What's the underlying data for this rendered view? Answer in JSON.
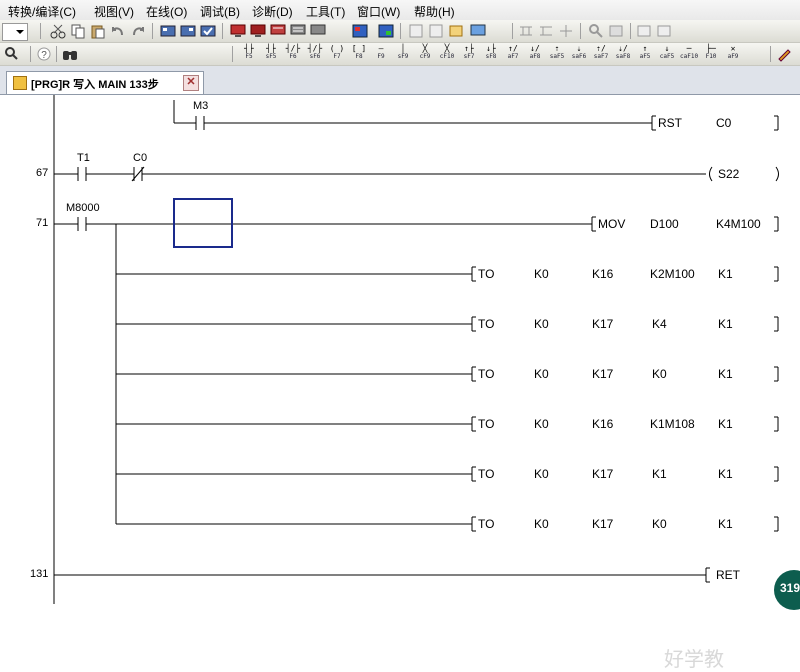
{
  "menu": [
    "转换/编译(C)",
    "视图(V)",
    "在线(O)",
    "调试(B)",
    "诊断(D)",
    "工具(T)",
    "窗口(W)",
    "帮助(H)"
  ],
  "toolbar2_keys": [
    {
      "sym": "┤├",
      "lab": "F5"
    },
    {
      "sym": "┤├",
      "lab": "sF5"
    },
    {
      "sym": "┤/├",
      "lab": "F6"
    },
    {
      "sym": "┤/├",
      "lab": "sF6"
    },
    {
      "sym": "( )",
      "lab": "F7"
    },
    {
      "sym": "[ ]",
      "lab": "F8"
    },
    {
      "sym": "—",
      "lab": "F9"
    },
    {
      "sym": "│",
      "lab": "sF9"
    },
    {
      "sym": "╳",
      "lab": "cF9"
    },
    {
      "sym": "╳",
      "lab": "cF10"
    },
    {
      "sym": "↑├",
      "lab": "sF7"
    },
    {
      "sym": "↓├",
      "lab": "sF8"
    },
    {
      "sym": "↑/",
      "lab": "aF7"
    },
    {
      "sym": "↓/",
      "lab": "aF8"
    },
    {
      "sym": "⇡",
      "lab": "saF5"
    },
    {
      "sym": "⇣",
      "lab": "saF6"
    },
    {
      "sym": "⇡/",
      "lab": "saF7"
    },
    {
      "sym": "⇣/",
      "lab": "saF8"
    },
    {
      "sym": "↑",
      "lab": "aF5"
    },
    {
      "sym": "↓",
      "lab": "caF5"
    },
    {
      "sym": "─",
      "lab": "caF10"
    },
    {
      "sym": "├─",
      "lab": "F10"
    },
    {
      "sym": "✕",
      "lab": "aF9"
    }
  ],
  "tab": {
    "label": "[PRG]R 写入 MAIN 133步",
    "close": "✕"
  },
  "steps": {
    "s67": "67",
    "s71": "71",
    "s131": "131"
  },
  "contacts": {
    "m3": "M3",
    "t1": "T1",
    "c0": "C0",
    "m8000": "M8000"
  },
  "instructions": {
    "rst": {
      "op": "RST",
      "arg": "C0"
    },
    "out": {
      "op": "S22"
    },
    "mov": {
      "op": "MOV",
      "a1": "D100",
      "a2": "K4M100"
    },
    "to": [
      {
        "op": "TO",
        "a1": "K0",
        "a2": "K16",
        "a3": "K2M100",
        "a4": "K1"
      },
      {
        "op": "TO",
        "a1": "K0",
        "a2": "K17",
        "a3": "K4",
        "a4": "K1"
      },
      {
        "op": "TO",
        "a1": "K0",
        "a2": "K17",
        "a3": "K0",
        "a4": "K1"
      },
      {
        "op": "TO",
        "a1": "K0",
        "a2": "K16",
        "a3": "K1M108",
        "a4": "K1"
      },
      {
        "op": "TO",
        "a1": "K0",
        "a2": "K17",
        "a3": "K1",
        "a4": "K1"
      },
      {
        "op": "TO",
        "a1": "K0",
        "a2": "K17",
        "a3": "K0",
        "a4": "K1"
      }
    ],
    "ret": {
      "op": "RET"
    }
  },
  "badge": "319",
  "watermark": "好学教",
  "colors": {
    "cursor": "#1a2a8c",
    "wire": "#000000"
  }
}
